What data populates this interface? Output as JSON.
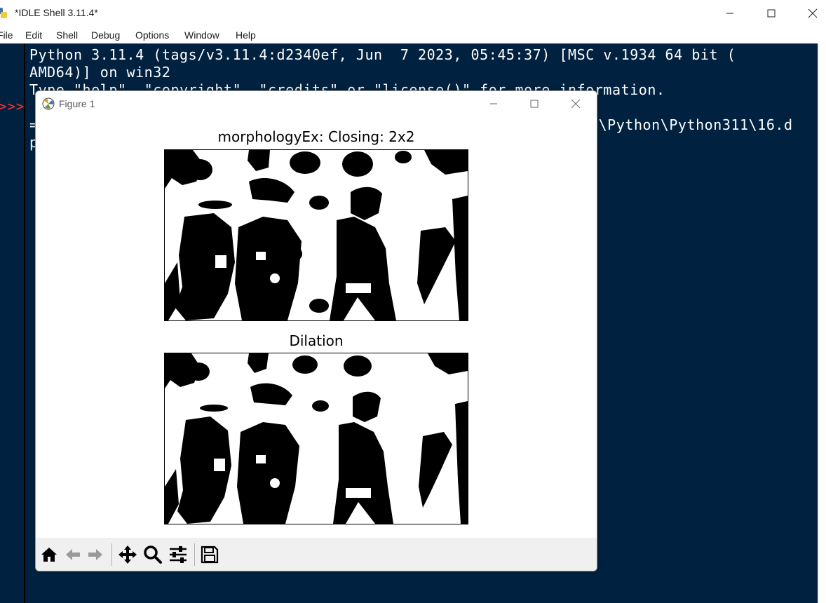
{
  "window": {
    "title": "*IDLE Shell 3.11.4*"
  },
  "menu": [
    "File",
    "Edit",
    "Shell",
    "Debug",
    "Options",
    "Window",
    "Help"
  ],
  "shell": {
    "prompt": ">>>",
    "lines": [
      "Python 3.11.4 (tags/v3.11.4:d2340ef, Jun  7 2023, 05:45:37) [MSC v.1934 64 bit (",
      "AMD64)] on win32",
      "Type \"help\", \"copyright\", \"credits\" or \"license()\" for more information.",
      "=",
      "p"
    ],
    "partial_line_right": "s\\Python\\Python311\\16.d"
  },
  "figure": {
    "title": "Figure 1",
    "plots": [
      {
        "title": "morphologyEx: Closing: 2x2"
      },
      {
        "title": "Dilation"
      }
    ],
    "toolbar": [
      "home-icon",
      "back-icon",
      "forward-icon",
      "pan-icon",
      "zoom-icon",
      "configure-subplots-icon",
      "save-icon"
    ]
  }
}
